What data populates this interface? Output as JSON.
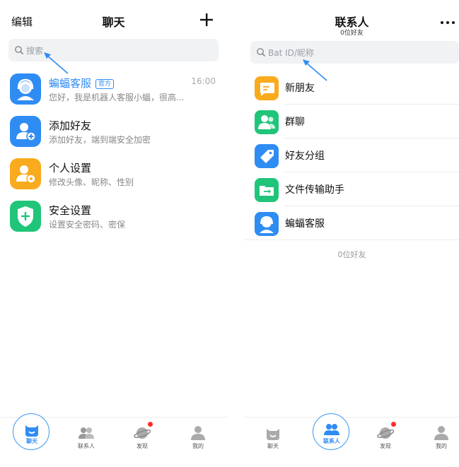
{
  "chats_screen": {
    "header": {
      "edit_label": "编辑",
      "title": "聊天",
      "add_icon": "plus-icon"
    },
    "search": {
      "placeholder": "搜索"
    },
    "chats": [
      {
        "name": "蝙蝠客服",
        "badge": "官方",
        "preview": "您好，我是机器人客服小蝠，很高...",
        "time": "16:00",
        "icon": "support-agent-icon",
        "color": "#2f8cf3"
      },
      {
        "name": "添加好友",
        "preview": "添加好友，端到端安全加密",
        "icon": "add-user-icon",
        "color": "#2f8cf3"
      },
      {
        "name": "个人设置",
        "preview": "修改头像、昵称、性别",
        "icon": "user-settings-icon",
        "color": "#f9aa1d"
      },
      {
        "name": "安全设置",
        "preview": "设置安全密码、密保",
        "icon": "shield-plus-icon",
        "color": "#21c57a"
      }
    ],
    "tabbar": [
      {
        "label": "聊天",
        "icon": "chat-face-icon",
        "active": true
      },
      {
        "label": "联系人",
        "icon": "contacts-icon",
        "active": false
      },
      {
        "label": "发现",
        "icon": "planet-icon",
        "active": false,
        "badge_dot": true
      },
      {
        "label": "我的",
        "icon": "profile-icon",
        "active": false
      }
    ]
  },
  "contacts_screen": {
    "header": {
      "title": "联系人",
      "subtitle": "0位好友",
      "more_icon": "more-dots-icon"
    },
    "search": {
      "placeholder": "Bat ID/昵称"
    },
    "contacts": [
      {
        "label": "新朋友",
        "icon": "new-friend-icon",
        "color": "#f9aa1d"
      },
      {
        "label": "群聊",
        "icon": "group-chat-icon",
        "color": "#21c57a"
      },
      {
        "label": "好友分组",
        "icon": "tag-icon",
        "color": "#2f8cf3"
      },
      {
        "label": "文件传输助手",
        "icon": "folder-transfer-icon",
        "color": "#21c57a"
      },
      {
        "label": "蝙蝠客服",
        "icon": "support-agent-icon",
        "color": "#2f8cf3"
      }
    ],
    "footer_count": "0位好友",
    "tabbar": [
      {
        "label": "聊天",
        "icon": "chat-face-icon",
        "active": false
      },
      {
        "label": "联系人",
        "icon": "contacts-icon",
        "active": true
      },
      {
        "label": "发现",
        "icon": "planet-icon",
        "active": false,
        "badge_dot": true
      },
      {
        "label": "我的",
        "icon": "profile-icon",
        "active": false
      }
    ]
  },
  "colors": {
    "accent": "#2f8cf3",
    "orange": "#f9aa1d",
    "green": "#21c57a",
    "badge_red": "#ff2b2b",
    "search_bg": "#f1f2f4"
  }
}
